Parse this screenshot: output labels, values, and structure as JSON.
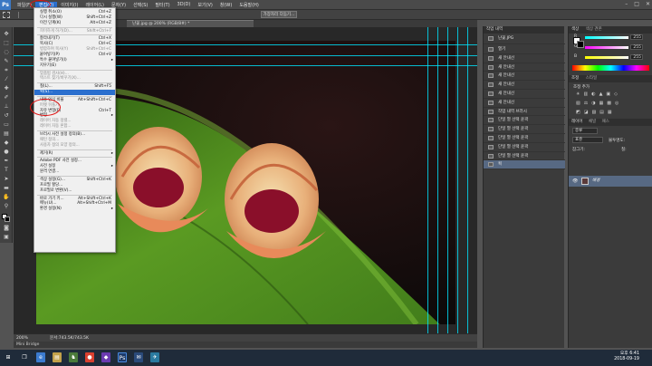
{
  "app": {
    "logo": "Ps"
  },
  "menubar": {
    "items": [
      "파일(F)",
      "편집(E)",
      "이미지(I)",
      "레이어(L)",
      "문자(Y)",
      "선택(S)",
      "필터(T)",
      "3D(D)",
      "보기(V)",
      "창(W)",
      "도움말(H)"
    ],
    "window_buttons": [
      "–",
      "□",
      "✕"
    ]
  },
  "options_bar": {
    "button_label": "가장자리 다듬기..."
  },
  "document": {
    "tab_title": "난꽃.jpg @ 200% (RGB/8#) *",
    "zoom": "200%",
    "doc_size": "문서:743.5K/743.5K"
  },
  "mini_bridge": {
    "label": "Mini Bridge"
  },
  "edit_menu": {
    "items": [
      {
        "label": "실행 취소(O)",
        "shortcut": "Ctrl+Z",
        "disabled": false
      },
      {
        "label": "다시 실행(W)",
        "shortcut": "Shift+Ctrl+Z",
        "disabled": false
      },
      {
        "label": "이전 단계(K)",
        "shortcut": "Alt+Ctrl+Z",
        "disabled": false
      },
      {
        "sep": true
      },
      {
        "label": "희미하게 하기(D)...",
        "shortcut": "Shift+Ctrl+F",
        "disabled": true
      },
      {
        "sep": true
      },
      {
        "label": "잘라내기(T)",
        "shortcut": "Ctrl+X",
        "disabled": false
      },
      {
        "label": "복사(C)",
        "shortcut": "Ctrl+C",
        "disabled": false
      },
      {
        "label": "병합하여 복사(Y)",
        "shortcut": "Shift+Ctrl+C",
        "disabled": true
      },
      {
        "label": "붙여넣기(P)",
        "shortcut": "Ctrl+V",
        "disabled": false
      },
      {
        "label": "특수 붙여넣기(I)",
        "shortcut": "",
        "disabled": false,
        "submenu": true
      },
      {
        "label": "지우기(E)",
        "shortcut": "",
        "disabled": false
      },
      {
        "sep": true
      },
      {
        "label": "맞춤법 검사(H)...",
        "shortcut": "",
        "disabled": true
      },
      {
        "label": "텍스트 찾기/바꾸기(X)...",
        "shortcut": "",
        "disabled": true
      },
      {
        "sep": true
      },
      {
        "label": "칠(L)...",
        "shortcut": "Shift+F5",
        "disabled": false
      },
      {
        "label": "획(S)...",
        "shortcut": "",
        "disabled": false,
        "highlight": true
      },
      {
        "sep": true
      },
      {
        "label": "내용 인식 비율",
        "shortcut": "Alt+Shift+Ctrl+C",
        "disabled": false
      },
      {
        "label": "퍼펫 뒤틀기",
        "shortcut": "",
        "disabled": true
      },
      {
        "label": "자유 변형(F)",
        "shortcut": "Ctrl+T",
        "disabled": false
      },
      {
        "label": "변형",
        "shortcut": "",
        "disabled": false,
        "submenu": true
      },
      {
        "label": "레이어 자동 정렬...",
        "shortcut": "",
        "disabled": true
      },
      {
        "label": "레이어 자동 혼합...",
        "shortcut": "",
        "disabled": true
      },
      {
        "sep": true
      },
      {
        "label": "브러시 사전 설정 정의(B)...",
        "shortcut": "",
        "disabled": false
      },
      {
        "label": "패턴 정의...",
        "shortcut": "",
        "disabled": true
      },
      {
        "label": "사용자 정의 모양 정의...",
        "shortcut": "",
        "disabled": true
      },
      {
        "sep": true
      },
      {
        "label": "제거(R)",
        "shortcut": "",
        "disabled": false,
        "submenu": true
      },
      {
        "sep": true
      },
      {
        "label": "Adobe PDF 사전 설정...",
        "shortcut": "",
        "disabled": false
      },
      {
        "label": "사전 설정",
        "shortcut": "",
        "disabled": false,
        "submenu": true
      },
      {
        "label": "원격 연결...",
        "shortcut": "",
        "disabled": false
      },
      {
        "sep": true
      },
      {
        "label": "색상 설정(G)...",
        "shortcut": "Shift+Ctrl+K",
        "disabled": false
      },
      {
        "label": "프로필 할당...",
        "shortcut": "",
        "disabled": false
      },
      {
        "label": "프로필로 변환(V)...",
        "shortcut": "",
        "disabled": false
      },
      {
        "sep": true
      },
      {
        "label": "바로 가기 키...",
        "shortcut": "Alt+Shift+Ctrl+K",
        "disabled": false
      },
      {
        "label": "메뉴(U)...",
        "shortcut": "Alt+Shift+Ctrl+M",
        "disabled": false
      },
      {
        "label": "환경 설정(N)",
        "shortcut": "",
        "disabled": false,
        "submenu": true
      }
    ]
  },
  "history_panel": {
    "tabs": [
      "작업 내역"
    ],
    "snapshot": "난꽃.JPG",
    "items": [
      "열기",
      "새 안내선",
      "새 안내선",
      "새 안내선",
      "새 안내선",
      "새 안내선",
      "새 안내선",
      "작업 내역 브러시",
      "단일 열 선택 윤곽",
      "단일 열 선택 윤곽",
      "단일 열 선택 윤곽",
      "단일 열 선택 윤곽",
      "단일 열 선택 윤곽",
      "획"
    ]
  },
  "color_panel": {
    "tabs": [
      "색상",
      "색상 견본"
    ],
    "channels": [
      {
        "label": "R",
        "value": "255"
      },
      {
        "label": "G",
        "value": "255"
      },
      {
        "label": "B",
        "value": "255"
      }
    ]
  },
  "adjust_panel": {
    "tabs": [
      "조정",
      "스타일"
    ],
    "title": "조정 추가"
  },
  "layers_panel": {
    "tabs": [
      "레이어",
      "채널",
      "패스"
    ],
    "kind": "종류",
    "blend": "표준",
    "opacity_label": "불투명도:",
    "lock_label": "잠그기:",
    "fill_label": "칠:",
    "layer_name": "배경"
  },
  "taskbar": {
    "time": "오후 6:41",
    "date": "2018-09-19"
  },
  "colors": {
    "accent": "#2b6fce",
    "history_selected": "#576983",
    "guide": "#00e5ff"
  }
}
